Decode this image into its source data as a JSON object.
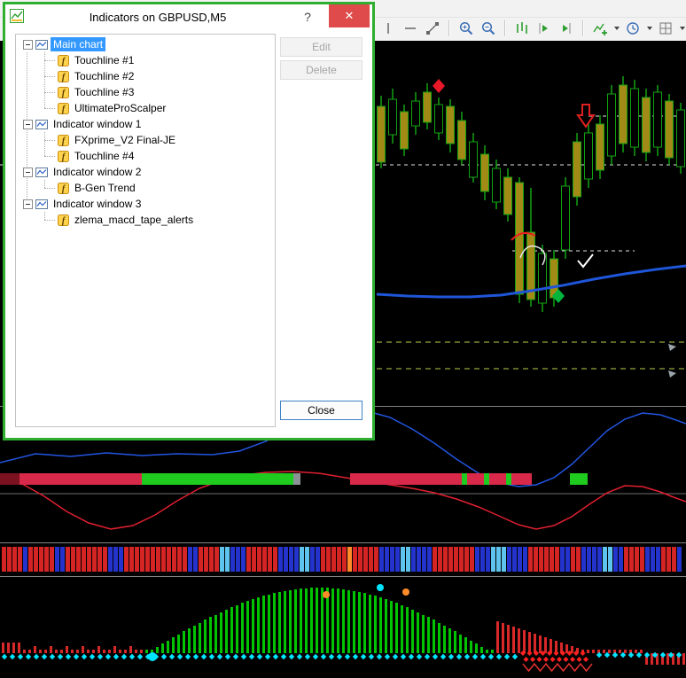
{
  "dialog": {
    "title": "Indicators on GBPUSD,M5",
    "help_button": "?",
    "close_glyph": "✕",
    "buttons": {
      "edit": "Edit",
      "delete": "Delete",
      "close": "Close"
    },
    "tree": {
      "roots": [
        {
          "label": "Main chart",
          "selected": true,
          "children": [
            "Touchline #1",
            "Touchline #2",
            "Touchline #3",
            "UltimateProScalper"
          ]
        },
        {
          "label": "Indicator window 1",
          "selected": false,
          "children": [
            "FXprime_V2 Final-JE",
            "Touchline #4"
          ]
        },
        {
          "label": "Indicator window 2",
          "selected": false,
          "children": [
            "B-Gen Trend"
          ]
        },
        {
          "label": "Indicator window 3",
          "selected": false,
          "children": [
            "zlema_macd_tape_alerts"
          ]
        }
      ]
    }
  },
  "toolbar": {
    "icons": [
      "vertical-line-icon",
      "horizontal-line-icon",
      "trendline-icon",
      "zoom-in-icon",
      "zoom-out-icon",
      "bar-chart-icon",
      "auto-scroll-icon",
      "chart-shift-icon",
      "indicators-icon",
      "periods-icon",
      "templates-icon"
    ]
  },
  "colors": {
    "dialog_border": "#2fae2f",
    "selection_blue": "#3399ff",
    "close_button_red": "#df4a4a",
    "candle_green": "#12a312",
    "candle_gold": "#a28a16",
    "ma_blue": "#1f55d8",
    "tape_red": "#d8294a",
    "tape_green": "#1ecb1e",
    "macd_green": "#00c400",
    "macd_red": "#d82828",
    "dot_cyan": "#00e5ff",
    "dot_orange": "#ff8c28"
  }
}
